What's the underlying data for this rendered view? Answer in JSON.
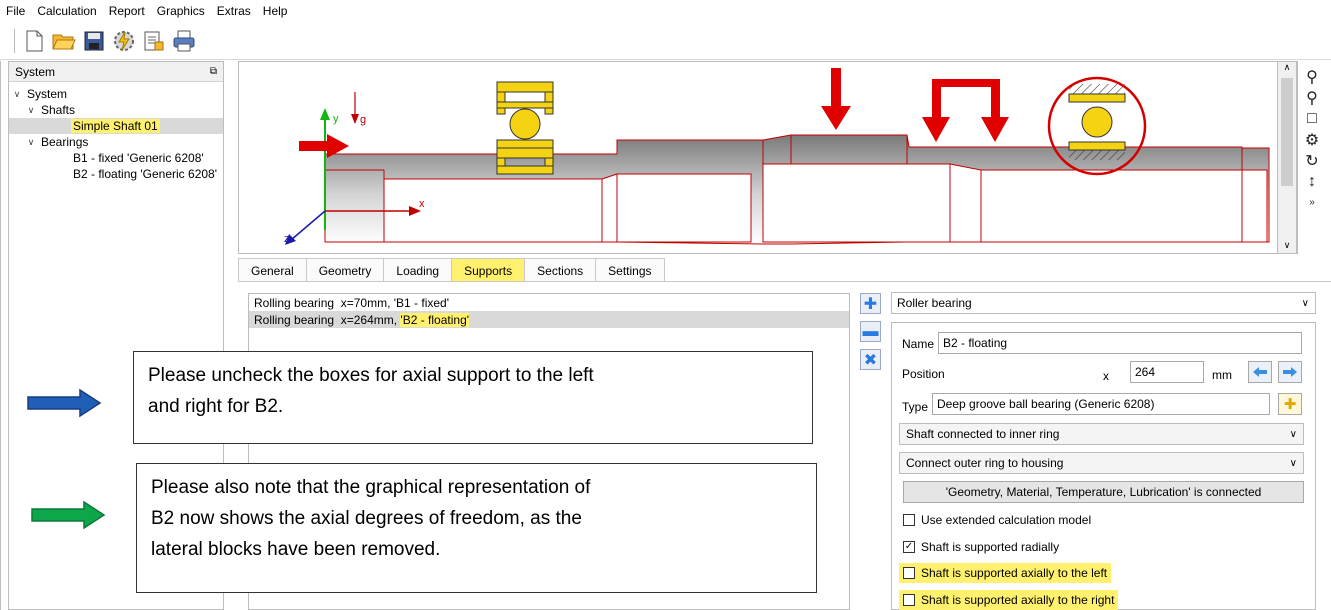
{
  "menu": [
    "File",
    "Calculation",
    "Report",
    "Graphics",
    "Extras",
    "Help"
  ],
  "toolbar": {
    "icons": [
      "new-file-icon",
      "open-folder-icon",
      "save-icon",
      "calculate-icon",
      "report-icon",
      "print-icon"
    ]
  },
  "sidebar": {
    "title": "System",
    "tree": [
      {
        "label": "System",
        "level": 0,
        "expanded": true
      },
      {
        "label": "Shafts",
        "level": 1,
        "expanded": true
      },
      {
        "label": "Simple Shaft 01",
        "level": 2,
        "selected": true
      },
      {
        "label": "Bearings",
        "level": 1,
        "expanded": true
      },
      {
        "label": "B1 - fixed 'Generic 6208'",
        "level": 2
      },
      {
        "label": "B2 - floating 'Generic 6208'",
        "level": 2
      }
    ]
  },
  "graphic": {
    "axis_y": "y",
    "axis_g": "g",
    "axis_x": "x",
    "axis_z": "z"
  },
  "tabs": [
    {
      "label": "General"
    },
    {
      "label": "Geometry"
    },
    {
      "label": "Loading"
    },
    {
      "label": "Supports",
      "active": true
    },
    {
      "label": "Sections"
    },
    {
      "label": "Settings"
    }
  ],
  "supports": {
    "rows": [
      {
        "prefix": "Rolling bearing  x=70mm, ",
        "name": "'B1 - fixed'"
      },
      {
        "prefix": "Rolling bearing  x=264mm, ",
        "name": "'B2 - floating'"
      }
    ]
  },
  "props": {
    "support_type": "Roller bearing",
    "name_label": "Name",
    "name_value": "B2 - floating",
    "position_label": "Position",
    "x_label": "x",
    "x_value": "264",
    "unit": "mm",
    "type_label": "Type",
    "type_value": "Deep groove ball bearing (Generic 6208)",
    "inner_ring": "Shaft connected to inner ring",
    "outer_ring": "Connect outer ring to housing",
    "connected_btn": "'Geometry, Material, Temperature, Lubrication' is connected",
    "chk_extended": "Use extended calculation model",
    "chk_radial": "Shaft is supported radially",
    "chk_axial_left": "Shaft is supported axially to the left",
    "chk_axial_right": "Shaft is supported axially to the right"
  },
  "notes": {
    "note1_line1": "Please uncheck the boxes for axial support to the left",
    "note1_line2": "and right for B2.",
    "note2_line1": "Please also note that the graphical representation of",
    "note2_line2": "B2 now shows the axial degrees of freedom, as the",
    "note2_line3": "lateral blocks have been removed."
  },
  "colors": {
    "highlight": "#fff06e",
    "force_arrow": "#e00000",
    "bearing": "#f5d312",
    "blue_arrow": "#1f5fb8",
    "green_arrow": "#0da64a"
  }
}
